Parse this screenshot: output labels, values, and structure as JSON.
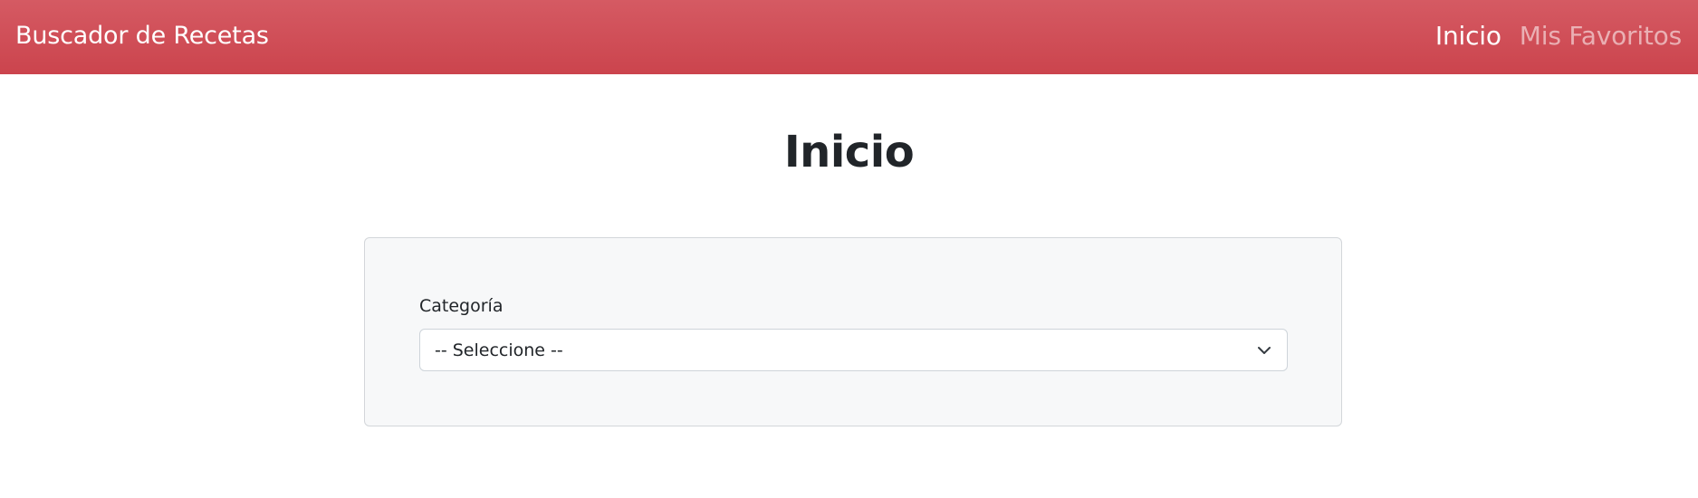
{
  "navbar": {
    "brand": "Buscador de Recetas",
    "links": [
      {
        "label": "Inicio",
        "active": true
      },
      {
        "label": "Mis Favoritos",
        "active": false
      }
    ]
  },
  "main": {
    "title": "Inicio",
    "form": {
      "category_label": "Categoría",
      "category_select": {
        "selected": "-- Seleccione --",
        "icon": "chevron-down-icon"
      }
    }
  },
  "colors": {
    "navbar_bg": "#cf4a53",
    "page_bg": "#ffffff",
    "card_bg": "#f7f8f9",
    "text": "#212529"
  }
}
